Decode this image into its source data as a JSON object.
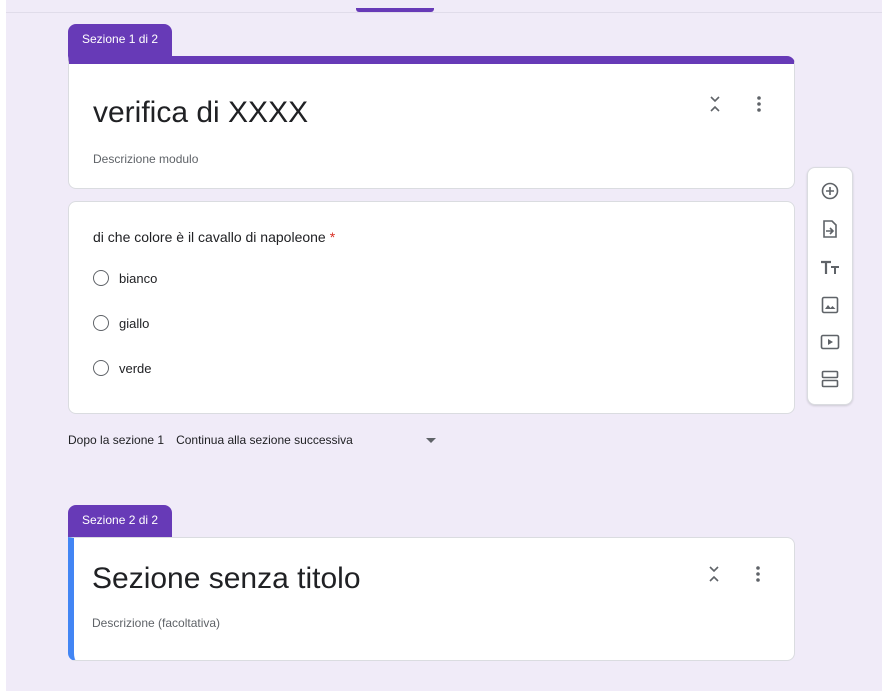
{
  "section1": {
    "tab_label": "Sezione 1 di 2",
    "title": "verifica di XXXX",
    "description": "Descrizione modulo"
  },
  "question": {
    "text": "di che colore è il cavallo di napoleone",
    "required_mark": "*",
    "options": [
      "bianco",
      "giallo",
      "verde"
    ]
  },
  "after_section": {
    "label": "Dopo la sezione 1",
    "value": "Continua alla sezione successiva"
  },
  "section2": {
    "tab_label": "Sezione 2 di 2",
    "title": "Sezione senza titolo",
    "description": "Descrizione (facoltativa)"
  },
  "toolbar_icons": [
    "add-question-icon",
    "import-questions-icon",
    "add-title-icon",
    "add-image-icon",
    "add-video-icon",
    "add-section-icon"
  ],
  "colors": {
    "accent": "#673ab7",
    "section_border": "#4285f4",
    "background": "#f0ebf8",
    "required": "#d93025"
  }
}
